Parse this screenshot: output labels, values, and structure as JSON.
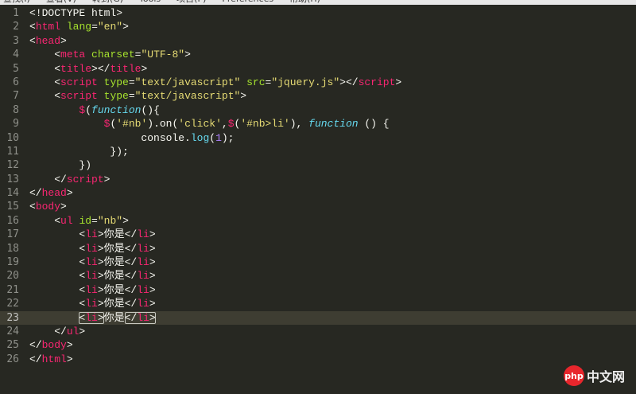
{
  "menu": [
    "查找(I)",
    "查看(V)",
    "转到(G)",
    "Tools",
    "项目(P)",
    "Preferences",
    "帮助(H)"
  ],
  "current_line": 23,
  "colors": {
    "background": "#272822",
    "tag": "#f92672",
    "attribute": "#a6e22e",
    "string": "#e6db74",
    "keyword": "#66d9ef",
    "number": "#ae81ff"
  },
  "lines": [
    [
      [
        "p",
        "<!DOCTYPE html>"
      ]
    ],
    [
      [
        "p",
        "<"
      ],
      [
        "t",
        "html"
      ],
      [
        "p",
        " "
      ],
      [
        "a",
        "lang"
      ],
      [
        "p",
        "="
      ],
      [
        "s",
        "\"en\""
      ],
      [
        "p",
        ">"
      ]
    ],
    [
      [
        "p",
        "<"
      ],
      [
        "t",
        "head"
      ],
      [
        "p",
        ">"
      ]
    ],
    [
      [
        "p",
        "    <"
      ],
      [
        "t",
        "meta"
      ],
      [
        "p",
        " "
      ],
      [
        "a",
        "charset"
      ],
      [
        "p",
        "="
      ],
      [
        "s",
        "\"UTF-8\""
      ],
      [
        "p",
        ">"
      ]
    ],
    [
      [
        "p",
        "    <"
      ],
      [
        "t",
        "title"
      ],
      [
        "p",
        "></"
      ],
      [
        "t",
        "title"
      ],
      [
        "p",
        ">"
      ]
    ],
    [
      [
        "p",
        "    <"
      ],
      [
        "t",
        "script"
      ],
      [
        "p",
        " "
      ],
      [
        "a",
        "type"
      ],
      [
        "p",
        "="
      ],
      [
        "s",
        "\"text/javascript\""
      ],
      [
        "p",
        " "
      ],
      [
        "a",
        "src"
      ],
      [
        "p",
        "="
      ],
      [
        "s",
        "\"jquery.js\""
      ],
      [
        "p",
        "></"
      ],
      [
        "t",
        "script"
      ],
      [
        "p",
        ">"
      ]
    ],
    [
      [
        "p",
        "    <"
      ],
      [
        "t",
        "script"
      ],
      [
        "p",
        " "
      ],
      [
        "a",
        "type"
      ],
      [
        "p",
        "="
      ],
      [
        "s",
        "\"text/javascript\""
      ],
      [
        "p",
        ">"
      ]
    ],
    [
      [
        "p",
        "        "
      ],
      [
        "d",
        "$"
      ],
      [
        "p",
        "("
      ],
      [
        "k",
        "function"
      ],
      [
        "p",
        "(){"
      ]
    ],
    [
      [
        "p",
        "            "
      ],
      [
        "d",
        "$"
      ],
      [
        "p",
        "("
      ],
      [
        "s",
        "'#nb'"
      ],
      [
        "p",
        ").on("
      ],
      [
        "s",
        "'click'"
      ],
      [
        "p",
        ","
      ],
      [
        "d",
        "$"
      ],
      [
        "p",
        "("
      ],
      [
        "s",
        "'#nb>li'"
      ],
      [
        "p",
        "), "
      ],
      [
        "k",
        "function"
      ],
      [
        "p",
        " () {"
      ]
    ],
    [
      [
        "p",
        "                  console."
      ],
      [
        "f",
        "log"
      ],
      [
        "p",
        "("
      ],
      [
        "n",
        "1"
      ],
      [
        "p",
        ");"
      ]
    ],
    [
      [
        "p",
        "             });"
      ]
    ],
    [
      [
        "p",
        "        })"
      ]
    ],
    [
      [
        "p",
        "    </"
      ],
      [
        "t",
        "script"
      ],
      [
        "p",
        ">"
      ]
    ],
    [
      [
        "p",
        "</"
      ],
      [
        "t",
        "head"
      ],
      [
        "p",
        ">"
      ]
    ],
    [
      [
        "p",
        "<"
      ],
      [
        "t",
        "body"
      ],
      [
        "p",
        ">"
      ]
    ],
    [
      [
        "p",
        "    <"
      ],
      [
        "t",
        "ul"
      ],
      [
        "p",
        " "
      ],
      [
        "a",
        "id"
      ],
      [
        "p",
        "="
      ],
      [
        "s",
        "\"nb\""
      ],
      [
        "p",
        ">"
      ]
    ],
    [
      [
        "p",
        "        <"
      ],
      [
        "t",
        "li"
      ],
      [
        "p",
        ">你是</"
      ],
      [
        "t",
        "li"
      ],
      [
        "p",
        ">"
      ]
    ],
    [
      [
        "p",
        "        <"
      ],
      [
        "t",
        "li"
      ],
      [
        "p",
        ">你是</"
      ],
      [
        "t",
        "li"
      ],
      [
        "p",
        ">"
      ]
    ],
    [
      [
        "p",
        "        <"
      ],
      [
        "t",
        "li"
      ],
      [
        "p",
        ">你是</"
      ],
      [
        "t",
        "li"
      ],
      [
        "p",
        ">"
      ]
    ],
    [
      [
        "p",
        "        <"
      ],
      [
        "t",
        "li"
      ],
      [
        "p",
        ">你是</"
      ],
      [
        "t",
        "li"
      ],
      [
        "p",
        ">"
      ]
    ],
    [
      [
        "p",
        "        <"
      ],
      [
        "t",
        "li"
      ],
      [
        "p",
        ">你是</"
      ],
      [
        "t",
        "li"
      ],
      [
        "p",
        ">"
      ]
    ],
    [
      [
        "p",
        "        <"
      ],
      [
        "t",
        "li"
      ],
      [
        "p",
        ">你是</"
      ],
      [
        "t",
        "li"
      ],
      [
        "p",
        ">"
      ]
    ],
    [
      [
        "p",
        "        "
      ],
      [
        "m",
        [
          [
            "p",
            "<"
          ],
          [
            "t",
            "li"
          ],
          [
            "p",
            ">"
          ]
        ]
      ],
      [
        "p",
        "你是"
      ],
      [
        "m",
        [
          [
            "p",
            "</"
          ],
          [
            "t",
            "li"
          ],
          [
            "p",
            ">"
          ]
        ]
      ]
    ],
    [
      [
        "p",
        "    </"
      ],
      [
        "t",
        "ul"
      ],
      [
        "p",
        ">"
      ]
    ],
    [
      [
        "p",
        "</"
      ],
      [
        "t",
        "body"
      ],
      [
        "p",
        ">"
      ]
    ],
    [
      [
        "p",
        "</"
      ],
      [
        "t",
        "html"
      ],
      [
        "p",
        ">"
      ]
    ]
  ],
  "watermark": {
    "badge": "php",
    "text": "中文网"
  }
}
